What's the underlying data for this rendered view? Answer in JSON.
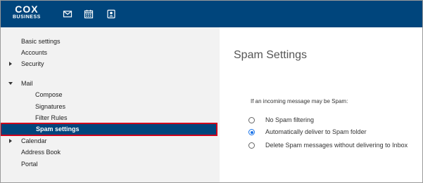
{
  "brand": {
    "name": "COX",
    "tagline": "BUSINESS"
  },
  "toolbar": {
    "icons": [
      "mail-icon",
      "calendar-icon",
      "contacts-icon"
    ]
  },
  "sidebar": {
    "items": [
      {
        "label": "Basic settings"
      },
      {
        "label": "Accounts"
      },
      {
        "label": "Security"
      },
      {
        "label": "Mail"
      },
      {
        "label": "Compose"
      },
      {
        "label": "Signatures"
      },
      {
        "label": "Filter Rules"
      },
      {
        "label": "Spam settings"
      },
      {
        "label": "Calendar"
      },
      {
        "label": "Address Book"
      },
      {
        "label": "Portal"
      }
    ]
  },
  "main": {
    "title": "Spam Settings",
    "question": "If an incoming message may be Spam:",
    "options": [
      {
        "label": "No Spam filtering",
        "selected": false
      },
      {
        "label": "Automatically deliver to Spam folder",
        "selected": true
      },
      {
        "label": "Delete Spam messages without delivering to Inbox",
        "selected": false
      }
    ]
  },
  "colors": {
    "header": "#00457c",
    "selection_outline": "#d0021b",
    "sidebar_bg": "#f2f2f2",
    "radio_accent": "#1a73e8"
  }
}
